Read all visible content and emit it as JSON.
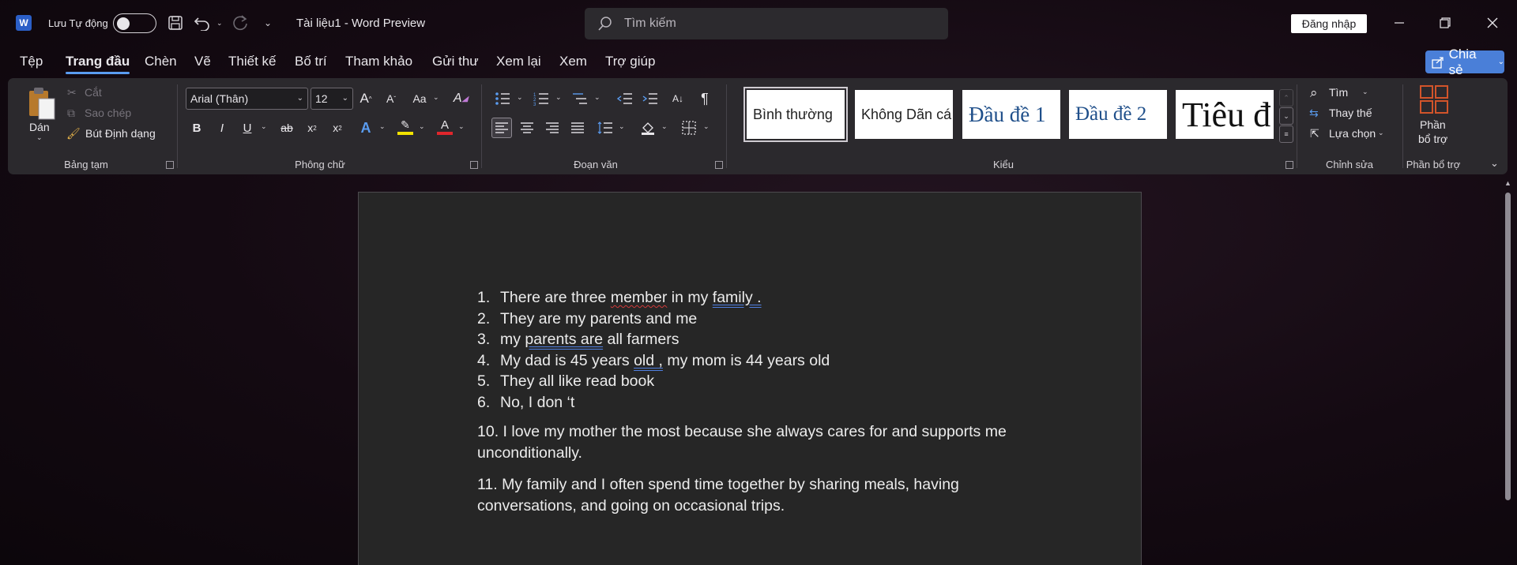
{
  "titlebar": {
    "autosave_label": "Lưu Tự động",
    "doc_title": "Tài liệu1  -  Word Preview",
    "search_placeholder": "Tìm kiếm",
    "signin_label": "Đăng nhập"
  },
  "tabs": [
    "Tệp",
    "Trang đầu",
    "Chèn",
    "Vẽ",
    "Thiết kế",
    "Bố trí",
    "Tham khảo",
    "Gửi thư",
    "Xem lại",
    "Xem",
    "Trợ giúp"
  ],
  "active_tab": "Trang đầu",
  "share_label": "Chia sẻ",
  "ribbon": {
    "clipboard": {
      "paste": "Dán",
      "cut": "Cắt",
      "copy": "Sao chép",
      "format_painter": "Bút Định dạng",
      "label": "Bảng tạm"
    },
    "font": {
      "font_name": "Arial (Thân)",
      "font_size": "12",
      "label": "Phông chữ"
    },
    "paragraph": {
      "label": "Đoạn văn"
    },
    "styles": {
      "items": [
        "Bình thường",
        "Không Dãn cá",
        "Đầu đề 1",
        "Đầu đề 2",
        "Tiêu đ"
      ],
      "label": "Kiểu"
    },
    "editing": {
      "find": "Tìm",
      "replace": "Thay thế",
      "select": "Lựa chọn",
      "label": "Chỉnh sửa"
    },
    "addins": {
      "button_line1": "Phần",
      "button_line2": "bổ trợ",
      "label": "Phần bổ trợ"
    }
  },
  "document": {
    "list": [
      {
        "num": "1.",
        "segments": [
          {
            "t": "There are three ",
            "s": ""
          },
          {
            "t": "member",
            "s": "sp"
          },
          {
            "t": " in my ",
            "s": ""
          },
          {
            "t": "family .",
            "s": "gr"
          }
        ]
      },
      {
        "num": "2.",
        "segments": [
          {
            "t": "They are my parents and me",
            "s": ""
          }
        ]
      },
      {
        "num": "3.",
        "segments": [
          {
            "t": "my ",
            "s": ""
          },
          {
            "t": "parents  are",
            "s": "gr"
          },
          {
            "t": " all farmers",
            "s": ""
          }
        ]
      },
      {
        "num": "4.",
        "segments": [
          {
            "t": "My dad is 45 years ",
            "s": ""
          },
          {
            "t": "old ,",
            "s": "gr"
          },
          {
            "t": " my mom is 44 years old",
            "s": ""
          }
        ]
      },
      {
        "num": "5.",
        "segments": [
          {
            "t": "They all like read book",
            "s": ""
          }
        ]
      },
      {
        "num": "6.",
        "segments": [
          {
            "t": "No, I don ‘t",
            "s": ""
          }
        ]
      }
    ],
    "para10": "10. I love my mother the most because she always cares for and supports me unconditionally.",
    "para11": "11. My family and I often spend time together by sharing meals, having conversations, and going on occasional trips."
  }
}
